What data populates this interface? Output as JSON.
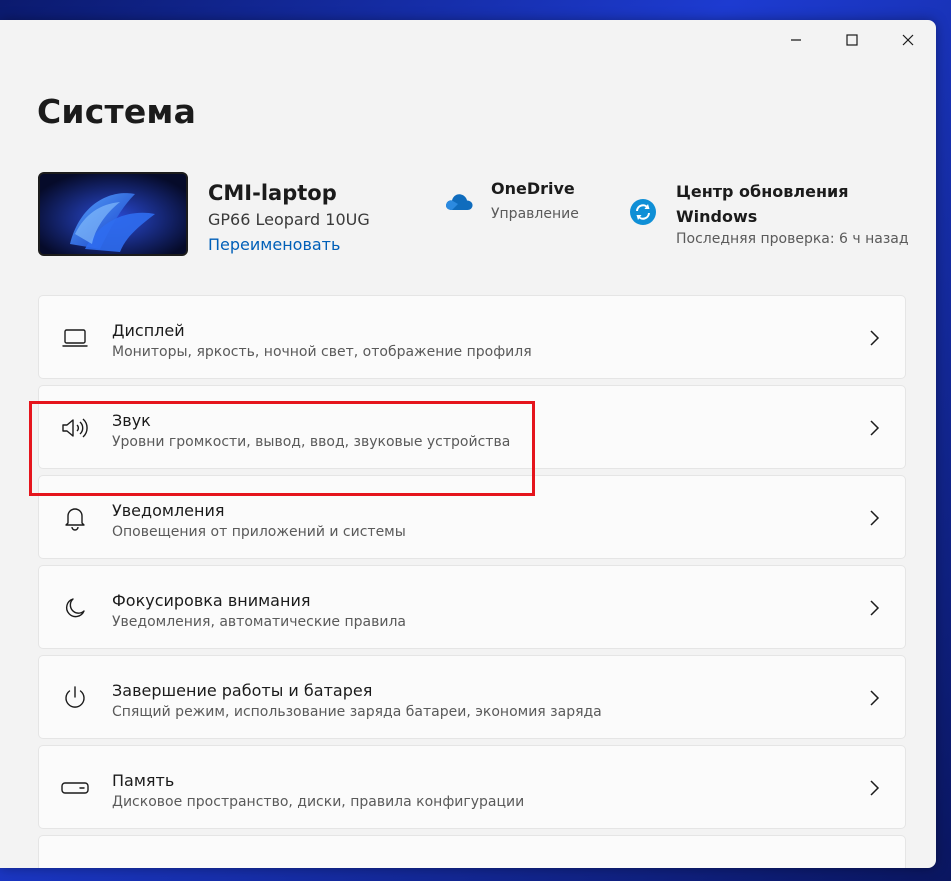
{
  "page": {
    "title": "Система"
  },
  "device": {
    "name": "CMI-laptop",
    "model": "GP66 Leopard 10UG",
    "rename_label": "Переименовать"
  },
  "onedrive": {
    "title": "OneDrive",
    "subtitle": "Управление",
    "icon": "cloud-icon",
    "color": "#0f6cbd"
  },
  "windows_update": {
    "title": "Центр обновления Windows",
    "subtitle": "Последняя проверка: 6 ч назад",
    "icon": "sync-icon",
    "color": "#0f8fd6"
  },
  "items": [
    {
      "id": "display",
      "icon": "laptop-icon",
      "title": "Дисплей",
      "desc": "Мониторы, яркость, ночной свет, отображение профиля"
    },
    {
      "id": "sound",
      "icon": "speaker-icon",
      "title": "Звук",
      "desc": "Уровни громкости, вывод, ввод, звуковые устройства"
    },
    {
      "id": "notifications",
      "icon": "bell-icon",
      "title": "Уведомления",
      "desc": "Оповещения от приложений и системы"
    },
    {
      "id": "focus",
      "icon": "moon-icon",
      "title": "Фокусировка внимания",
      "desc": "Уведомления, автоматические правила"
    },
    {
      "id": "power",
      "icon": "power-icon",
      "title": "Завершение работы и батарея",
      "desc": "Спящий режим, использование заряда батареи, экономия заряда"
    },
    {
      "id": "storage",
      "icon": "drive-icon",
      "title": "Память",
      "desc": "Дисковое пространство, диски, правила конфигурации"
    }
  ],
  "window_controls": {
    "minimize": "minimize-icon",
    "maximize": "maximize-icon",
    "close": "close-icon"
  },
  "colors": {
    "accent": "#005fb8",
    "highlight": "#e5141c"
  }
}
